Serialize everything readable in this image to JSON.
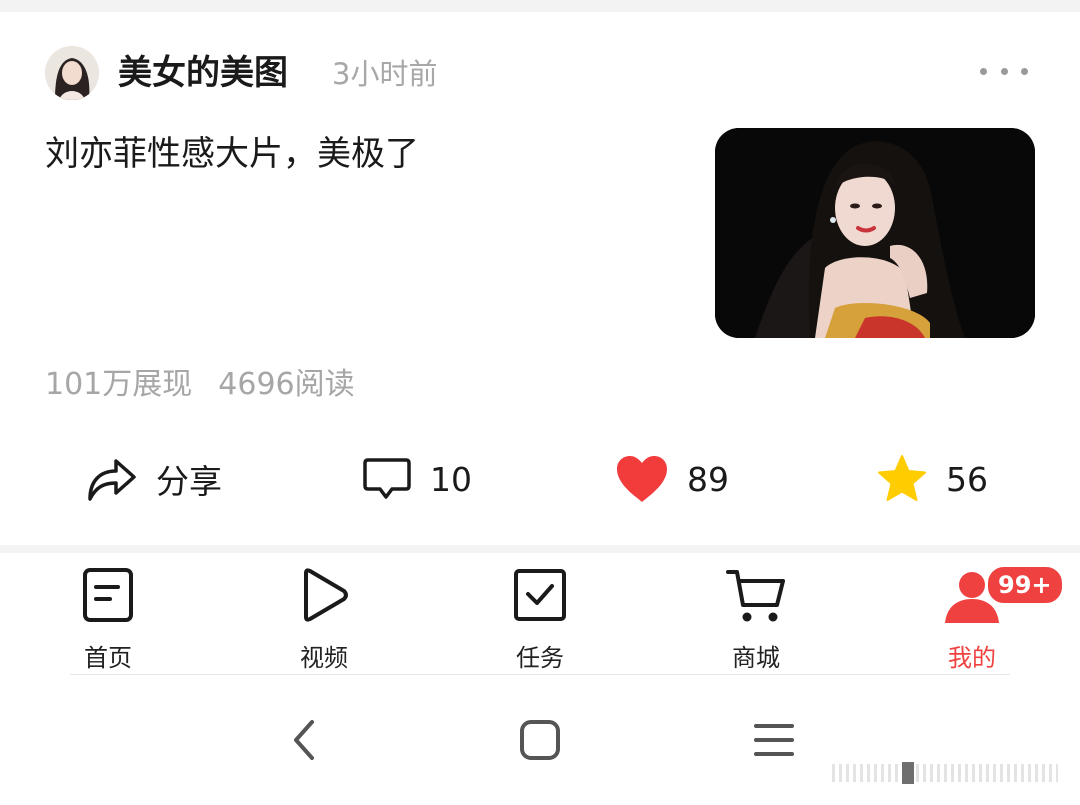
{
  "post": {
    "author": "美女的美图",
    "time": "3小时前",
    "text": "刘亦菲性感大片，美极了",
    "impressions": "101万展现",
    "reads": "4696阅读"
  },
  "actions": {
    "share_label": "分享",
    "comment_count": "10",
    "like_count": "89",
    "favorite_count": "56"
  },
  "tabbar": {
    "items": [
      {
        "label": "首页",
        "icon": "document-icon"
      },
      {
        "label": "视频",
        "icon": "play-icon"
      },
      {
        "label": "任务",
        "icon": "checkbox-icon"
      },
      {
        "label": "商城",
        "icon": "cart-icon"
      },
      {
        "label": "我的",
        "icon": "person-icon"
      }
    ],
    "badge": "99+",
    "active_index": 4
  },
  "colors": {
    "accent": "#f04141",
    "like": "#f23c3c",
    "star": "#ffcc00",
    "muted": "#a8a8a8"
  }
}
